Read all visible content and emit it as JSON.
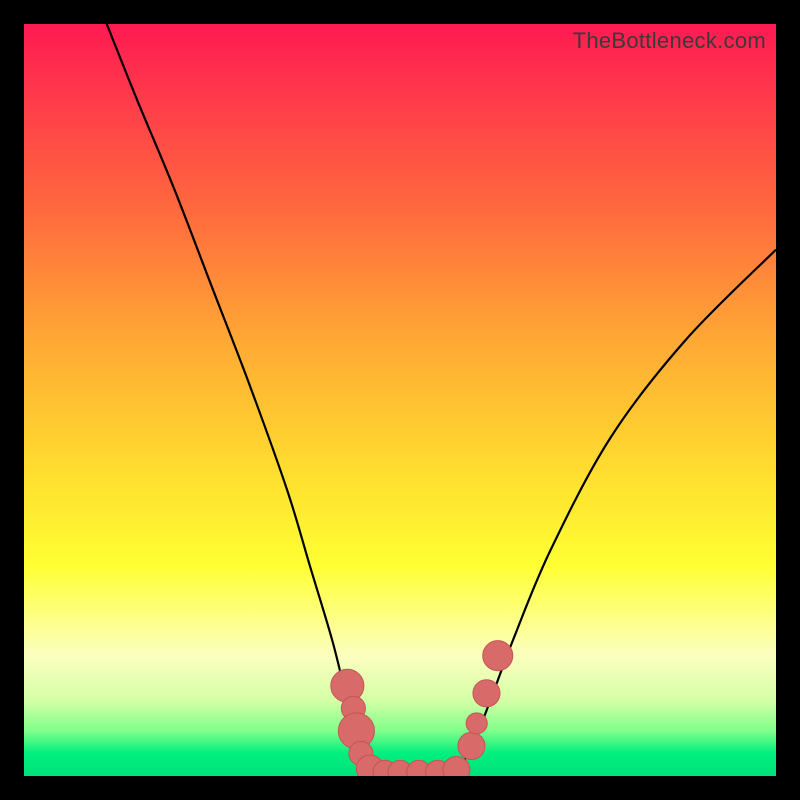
{
  "watermark": "TheBottleneck.com",
  "chart_data": {
    "type": "line",
    "title": "",
    "xlabel": "",
    "ylabel": "",
    "xlim": [
      0,
      100
    ],
    "ylim": [
      0,
      100
    ],
    "left_curve": {
      "x": [
        11,
        15,
        20,
        25,
        30,
        35,
        38,
        41,
        43,
        44.5,
        46
      ],
      "y": [
        100,
        90,
        78,
        65,
        52,
        38,
        28,
        18,
        10,
        5,
        1
      ]
    },
    "right_curve": {
      "x": [
        58,
        60,
        62,
        65,
        70,
        78,
        88,
        100
      ],
      "y": [
        1,
        5,
        10,
        18,
        30,
        45,
        58,
        70
      ]
    },
    "flat_segment": {
      "x": [
        46,
        58
      ],
      "y": [
        0.5,
        0.5
      ]
    },
    "markers": [
      {
        "x": 43.0,
        "y": 12,
        "r": 2.2
      },
      {
        "x": 43.8,
        "y": 9,
        "r": 1.6
      },
      {
        "x": 44.2,
        "y": 6,
        "r": 2.4
      },
      {
        "x": 44.8,
        "y": 3,
        "r": 1.6
      },
      {
        "x": 46.0,
        "y": 1,
        "r": 1.8
      },
      {
        "x": 48.0,
        "y": 0.5,
        "r": 1.6
      },
      {
        "x": 50.0,
        "y": 0.5,
        "r": 1.6
      },
      {
        "x": 52.5,
        "y": 0.5,
        "r": 1.6
      },
      {
        "x": 55.0,
        "y": 0.5,
        "r": 1.6
      },
      {
        "x": 57.5,
        "y": 0.8,
        "r": 1.8
      },
      {
        "x": 59.5,
        "y": 4,
        "r": 1.8
      },
      {
        "x": 60.2,
        "y": 7,
        "r": 1.4
      },
      {
        "x": 61.5,
        "y": 11,
        "r": 1.8
      },
      {
        "x": 63.0,
        "y": 16,
        "r": 2.0
      }
    ]
  }
}
